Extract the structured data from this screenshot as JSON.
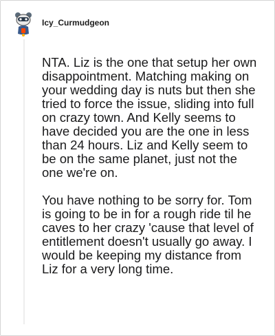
{
  "comment": {
    "author": {
      "username": "Icy_Curmudgeon",
      "avatar_icon": "snoo-avatar-icon"
    },
    "paragraphs": [
      "NTA. Liz is the one that setup her own disappointment. Matching making on your wedding day is nuts but then she tried to force the issue, sliding into full on crazy town. And Kelly seems to have decided you are the one in less than 24 hours. Liz and Kelly seem to be on the same planet, just not the one we're on.",
      "You have nothing to be sorry for. Tom is going to be in for a rough ride til he caves to her crazy 'cause that level of entitlement doesn't usually go away. I would be keeping my distance from Liz for a very long time."
    ]
  },
  "colors": {
    "border": "#d4d4d4",
    "text": "#1a1a1b",
    "thread_line": "#ededed",
    "avatar_bg": "#e8e8e8",
    "avatar_accent_red": "#ff4500",
    "avatar_accent_blue": "#3a5a8c"
  }
}
